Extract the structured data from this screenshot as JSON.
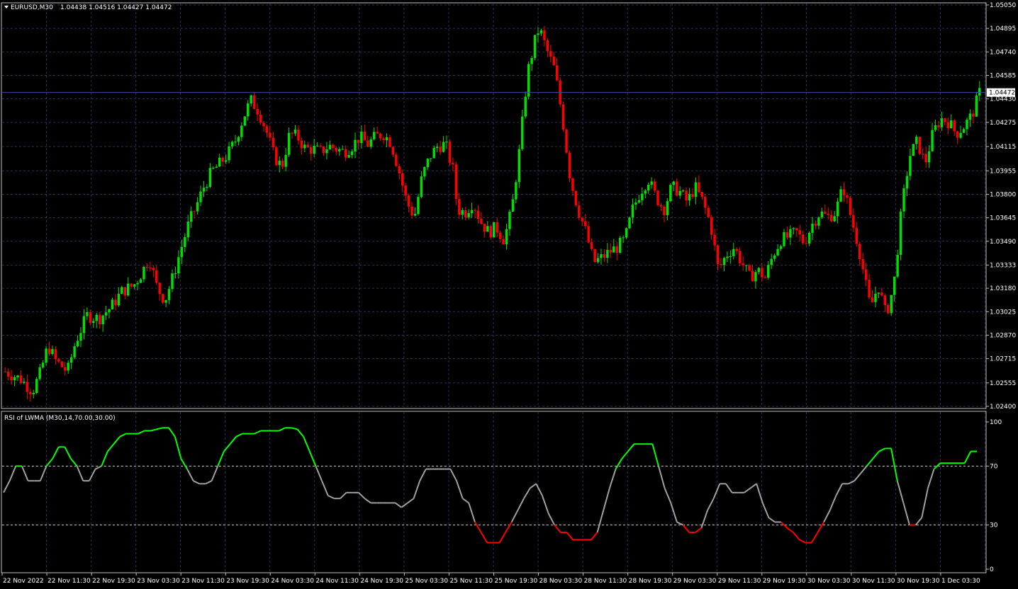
{
  "window": {
    "symbol_label": "EURUSD,M30",
    "ohlc_label": "1.04438 1.04516 1.04427 1.04472"
  },
  "colors": {
    "background": "#000000",
    "grid": "#2a2f55",
    "bull_candle": "#00e000",
    "bear_candle": "#ff0000",
    "price_line": "#3a4a9a",
    "indicator_up": "#00ff00",
    "indicator_neutral": "#a0a0a0",
    "indicator_down": "#ff0000",
    "level_line": "#c8c8c8"
  },
  "chart_data": [
    {
      "type": "candlestick",
      "title": "EURUSD,M30",
      "ylim": [
        1.024,
        1.0505
      ],
      "y_ticks": [
        "1.05050",
        "1.04895",
        "1.04740",
        "1.04585",
        "1.04430",
        "1.04275",
        "1.04115",
        "1.03955",
        "1.03800",
        "1.03645",
        "1.03490",
        "1.03333",
        "1.03180",
        "1.03025",
        "1.02870",
        "1.02715",
        "1.02555",
        "1.02400"
      ],
      "current_price": 1.04472,
      "current_price_label": "1.04472",
      "last_ohlc": {
        "open": 1.04438,
        "high": 1.04516,
        "low": 1.04427,
        "close": 1.04472
      },
      "price_path": [
        [
          0,
          1.0263
        ],
        [
          4,
          1.0258
        ],
        [
          7,
          1.025
        ],
        [
          9,
          1.0262
        ],
        [
          11,
          1.028
        ],
        [
          13,
          1.027
        ],
        [
          16,
          1.0263
        ],
        [
          18,
          1.0282
        ],
        [
          21,
          1.03
        ],
        [
          24,
          1.0298
        ],
        [
          27,
          1.0305
        ],
        [
          30,
          1.0316
        ],
        [
          33,
          1.032
        ],
        [
          35,
          1.0328
        ],
        [
          37,
          1.0338
        ],
        [
          39,
          1.0318
        ],
        [
          41,
          1.031
        ],
        [
          43,
          1.0325
        ],
        [
          45,
          1.0343
        ],
        [
          47,
          1.036
        ],
        [
          49,
          1.0372
        ],
        [
          51,
          1.0385
        ],
        [
          53,
          1.0395
        ],
        [
          55,
          1.04
        ],
        [
          57,
          1.0406
        ],
        [
          59,
          1.0415
        ],
        [
          61,
          1.043
        ],
        [
          63,
          1.0442
        ],
        [
          65,
          1.0435
        ],
        [
          67,
          1.0422
        ],
        [
          69,
          1.0405
        ],
        [
          71,
          1.0398
        ],
        [
          73,
          1.042
        ],
        [
          75,
          1.0418
        ],
        [
          77,
          1.041
        ],
        [
          79,
          1.041
        ],
        [
          81,
          1.0408
        ],
        [
          83,
          1.0412
        ],
        [
          85,
          1.041
        ],
        [
          87,
          1.0408
        ],
        [
          89,
          1.0412
        ],
        [
          91,
          1.0418
        ],
        [
          93,
          1.0413
        ],
        [
          95,
          1.0418
        ],
        [
          97,
          1.042
        ],
        [
          99,
          1.0414
        ],
        [
          101,
          1.0396
        ],
        [
          103,
          1.0375
        ],
        [
          105,
          1.0365
        ],
        [
          107,
          1.0392
        ],
        [
          109,
          1.0405
        ],
        [
          111,
          1.0412
        ],
        [
          113,
          1.0413
        ],
        [
          115,
          1.0395
        ],
        [
          116,
          1.037
        ],
        [
          118,
          1.0368
        ],
        [
          120,
          1.0375
        ],
        [
          122,
          1.0362
        ],
        [
          124,
          1.0355
        ],
        [
          126,
          1.0358
        ],
        [
          128,
          1.035
        ],
        [
          130,
          1.037
        ],
        [
          132,
          1.041
        ],
        [
          134,
          1.046
        ],
        [
          136,
          1.0482
        ],
        [
          137,
          1.049
        ],
        [
          139,
          1.0475
        ],
        [
          141,
          1.0462
        ],
        [
          143,
          1.043
        ],
        [
          145,
          1.039
        ],
        [
          147,
          1.037
        ],
        [
          149,
          1.0355
        ],
        [
          151,
          1.0335
        ],
        [
          153,
          1.0338
        ],
        [
          155,
          1.0342
        ],
        [
          157,
          1.0345
        ],
        [
          159,
          1.035
        ],
        [
          161,
          1.037
        ],
        [
          163,
          1.0382
        ],
        [
          165,
          1.039
        ],
        [
          167,
          1.0378
        ],
        [
          169,
          1.037
        ],
        [
          171,
          1.0385
        ],
        [
          173,
          1.0382
        ],
        [
          175,
          1.0375
        ],
        [
          177,
          1.0385
        ],
        [
          179,
          1.0375
        ],
        [
          181,
          1.036
        ],
        [
          183,
          1.033
        ],
        [
          185,
          1.034
        ],
        [
          187,
          1.0345
        ],
        [
          189,
          1.0335
        ],
        [
          191,
          1.0325
        ],
        [
          193,
          1.033
        ],
        [
          195,
          1.0325
        ],
        [
          197,
          1.034
        ],
        [
          199,
          1.035
        ],
        [
          201,
          1.0352
        ],
        [
          203,
          1.0355
        ],
        [
          205,
          1.0348
        ],
        [
          207,
          1.036
        ],
        [
          209,
          1.0368
        ],
        [
          211,
          1.0365
        ],
        [
          213,
          1.0368
        ],
        [
          215,
          1.0385
        ],
        [
          217,
          1.0365
        ],
        [
          219,
          1.0345
        ],
        [
          221,
          1.0318
        ],
        [
          222,
          1.0305
        ],
        [
          224,
          1.032
        ],
        [
          226,
          1.03
        ],
        [
          228,
          1.032
        ],
        [
          230,
          1.037
        ],
        [
          232,
          1.0405
        ],
        [
          234,
          1.0415
        ],
        [
          236,
          1.04
        ],
        [
          238,
          1.042
        ],
        [
          240,
          1.043
        ],
        [
          242,
          1.0428
        ],
        [
          244,
          1.042
        ],
        [
          246,
          1.0425
        ],
        [
          248,
          1.0432
        ],
        [
          250,
          1.0447
        ]
      ],
      "x_ticks": [
        "22 Nov 2022",
        "22 Nov 11:30",
        "22 Nov 19:30",
        "23 Nov 03:30",
        "23 Nov 11:30",
        "23 Nov 19:30",
        "24 Nov 03:30",
        "24 Nov 11:30",
        "24 Nov 19:30",
        "25 Nov 03:30",
        "25 Nov 11:30",
        "25 Nov 19:30",
        "28 Nov 03:30",
        "28 Nov 11:30",
        "28 Nov 19:30",
        "29 Nov 03:30",
        "29 Nov 11:30",
        "29 Nov 19:30",
        "30 Nov 03:30",
        "30 Nov 11:30",
        "30 Nov 19:30",
        "1 Dec 03:30"
      ]
    },
    {
      "type": "line",
      "title": "RSI of LWMA (M30,14,70.00,30.00)",
      "ylim": [
        0,
        100
      ],
      "y_ticks": [
        "100",
        "70",
        "30",
        "0"
      ],
      "levels": [
        70,
        30
      ],
      "series": [
        {
          "values": [
            [
              0,
              52
            ],
            [
              2,
              60
            ],
            [
              4,
              70
            ],
            [
              6,
              70
            ],
            [
              8,
              60
            ],
            [
              10,
              60
            ],
            [
              12,
              60
            ],
            [
              14,
              70
            ],
            [
              16,
              75
            ],
            [
              18,
              83
            ],
            [
              20,
              83
            ],
            [
              22,
              75
            ],
            [
              24,
              70
            ],
            [
              26,
              60
            ],
            [
              28,
              60
            ],
            [
              30,
              68
            ],
            [
              32,
              70
            ],
            [
              34,
              80
            ],
            [
              36,
              85
            ],
            [
              38,
              90
            ],
            [
              40,
              92
            ],
            [
              42,
              92
            ],
            [
              44,
              92
            ],
            [
              46,
              94
            ],
            [
              48,
              94
            ],
            [
              50,
              95
            ],
            [
              52,
              96
            ],
            [
              54,
              96
            ],
            [
              56,
              90
            ],
            [
              58,
              75
            ],
            [
              60,
              68
            ],
            [
              62,
              60
            ],
            [
              64,
              58
            ],
            [
              66,
              58
            ],
            [
              68,
              60
            ],
            [
              70,
              70
            ],
            [
              72,
              80
            ],
            [
              74,
              85
            ],
            [
              76,
              90
            ],
            [
              78,
              92
            ],
            [
              80,
              92
            ],
            [
              82,
              92
            ],
            [
              84,
              94
            ],
            [
              86,
              94
            ],
            [
              88,
              94
            ],
            [
              90,
              94
            ],
            [
              92,
              96
            ],
            [
              94,
              96
            ],
            [
              96,
              95
            ],
            [
              98,
              90
            ],
            [
              100,
              80
            ],
            [
              102,
              70
            ],
            [
              104,
              60
            ],
            [
              106,
              50
            ],
            [
              108,
              48
            ],
            [
              110,
              48
            ],
            [
              112,
              52
            ],
            [
              114,
              52
            ],
            [
              116,
              52
            ],
            [
              118,
              48
            ],
            [
              120,
              45
            ],
            [
              122,
              45
            ],
            [
              124,
              45
            ],
            [
              126,
              45
            ],
            [
              128,
              45
            ],
            [
              130,
              42
            ],
            [
              132,
              45
            ],
            [
              134,
              48
            ],
            [
              136,
              60
            ],
            [
              138,
              68
            ],
            [
              140,
              68
            ],
            [
              142,
              68
            ],
            [
              144,
              68
            ],
            [
              146,
              68
            ],
            [
              148,
              60
            ],
            [
              150,
              48
            ],
            [
              152,
              45
            ],
            [
              154,
              32
            ],
            [
              156,
              25
            ],
            [
              158,
              18
            ],
            [
              160,
              18
            ],
            [
              162,
              18
            ],
            [
              164,
              25
            ],
            [
              166,
              32
            ],
            [
              168,
              40
            ],
            [
              170,
              48
            ],
            [
              172,
              55
            ],
            [
              174,
              58
            ],
            [
              176,
              50
            ],
            [
              178,
              38
            ],
            [
              180,
              30
            ],
            [
              182,
              25
            ],
            [
              184,
              25
            ],
            [
              186,
              20
            ],
            [
              188,
              20
            ],
            [
              190,
              20
            ],
            [
              192,
              20
            ],
            [
              194,
              25
            ],
            [
              196,
              40
            ],
            [
              198,
              55
            ],
            [
              200,
              68
            ],
            [
              202,
              75
            ],
            [
              204,
              80
            ],
            [
              206,
              85
            ],
            [
              208,
              85
            ],
            [
              210,
              85
            ],
            [
              212,
              85
            ],
            [
              214,
              70
            ],
            [
              216,
              55
            ],
            [
              218,
              45
            ],
            [
              220,
              32
            ],
            [
              222,
              30
            ],
            [
              224,
              25
            ],
            [
              226,
              25
            ],
            [
              228,
              28
            ],
            [
              230,
              40
            ],
            [
              232,
              48
            ],
            [
              234,
              58
            ],
            [
              236,
              58
            ],
            [
              238,
              52
            ],
            [
              240,
              52
            ],
            [
              242,
              52
            ],
            [
              244,
              55
            ],
            [
              246,
              58
            ],
            [
              248,
              45
            ],
            [
              250,
              35
            ],
            [
              252,
              32
            ],
            [
              254,
              32
            ],
            [
              256,
              28
            ],
            [
              258,
              25
            ],
            [
              260,
              20
            ],
            [
              262,
              18
            ],
            [
              264,
              18
            ],
            [
              266,
              25
            ],
            [
              268,
              32
            ],
            [
              270,
              40
            ],
            [
              272,
              50
            ],
            [
              274,
              58
            ],
            [
              276,
              58
            ],
            [
              278,
              60
            ],
            [
              280,
              65
            ],
            [
              282,
              70
            ],
            [
              284,
              75
            ],
            [
              286,
              80
            ],
            [
              288,
              82
            ],
            [
              290,
              82
            ],
            [
              292,
              60
            ],
            [
              294,
              45
            ],
            [
              296,
              30
            ],
            [
              298,
              30
            ],
            [
              300,
              35
            ],
            [
              302,
              55
            ],
            [
              304,
              68
            ],
            [
              306,
              72
            ],
            [
              308,
              72
            ],
            [
              310,
              72
            ],
            [
              312,
              72
            ],
            [
              314,
              72
            ],
            [
              316,
              80
            ],
            [
              318,
              80
            ]
          ]
        }
      ]
    }
  ]
}
